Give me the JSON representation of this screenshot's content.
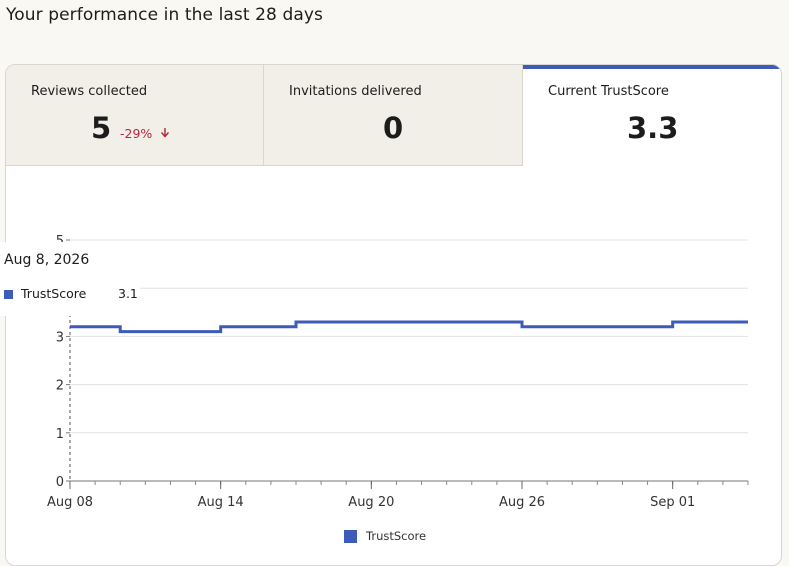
{
  "page": {
    "title": "Your performance in the last 28 days"
  },
  "tabs": [
    {
      "label": "Reviews collected",
      "value": "5",
      "delta": "-29%",
      "delta_icon": "arrow-down-icon"
    },
    {
      "label": "Invitations delivered",
      "value": "0"
    },
    {
      "label": "Current TrustScore",
      "value": "3.3"
    }
  ],
  "tooltip": {
    "date": "Aug 8, 2026",
    "series_name": "TrustScore",
    "value": "3.1"
  },
  "colors": {
    "accent": "#3d5bb8",
    "negative": "#b1283b"
  },
  "chart_data": {
    "type": "line",
    "step": true,
    "series": [
      {
        "name": "TrustScore",
        "x": [
          "2026-08-08",
          "2026-08-10",
          "2026-08-14",
          "2026-08-17",
          "2026-08-26",
          "2026-09-01",
          "2026-09-04"
        ],
        "values": [
          3.2,
          3.1,
          3.2,
          3.3,
          3.2,
          3.3,
          3.3
        ]
      }
    ],
    "x_ticks": [
      "Aug 08",
      "Aug 14",
      "Aug 20",
      "Aug 26",
      "Sep 01"
    ],
    "x_range": [
      "2026-08-08",
      "2026-09-04"
    ],
    "y_ticks": [
      0,
      1,
      2,
      3,
      4,
      5
    ],
    "ylim": [
      0,
      5
    ],
    "grid": true,
    "legend": "bottom-center",
    "legend_label": "TrustScore"
  }
}
